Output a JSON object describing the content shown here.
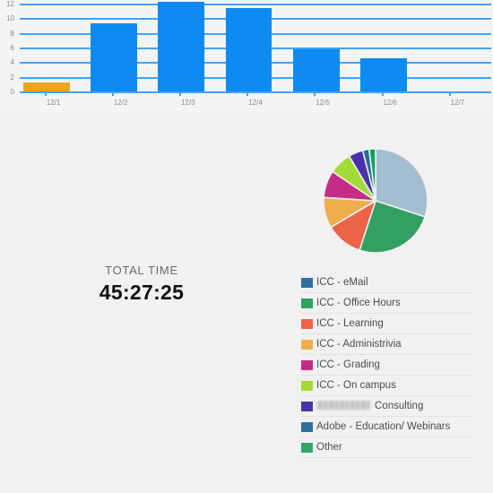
{
  "chart_data": [
    {
      "type": "bar",
      "title": "",
      "xlabel": "",
      "ylabel": "",
      "categories": [
        "12/1",
        "12/2",
        "12/3",
        "12/4",
        "12/5",
        "12/6",
        "12/7"
      ],
      "values": [
        1.5,
        9.6,
        12.5,
        11.6,
        6.0,
        4.8,
        0.1
      ],
      "colors": [
        "#eda323",
        "#0d8bf2",
        "#0d8bf2",
        "#0d8bf2",
        "#0d8bf2",
        "#0d8bf2",
        "#eda323"
      ],
      "ylim": [
        0,
        12
      ],
      "yticks": [
        0,
        2,
        4,
        6,
        8,
        10,
        12
      ],
      "ytick_labels": [
        "0",
        "2",
        "4",
        "6",
        "8",
        "10",
        "12"
      ],
      "grid": true,
      "legend": "none",
      "gridline_color": "#41a3f5",
      "plot_background": "#f4f4f4"
    },
    {
      "type": "pie",
      "title": "",
      "legend_position": "below",
      "labels": [
        "ICC - eMail",
        "ICC - Office Hours",
        "ICC - Learning",
        "ICC - Administrivia",
        "ICC - Grading",
        "ICC - On campus",
        "Consulting",
        "Adobe - Education/ Webinars",
        "Other"
      ],
      "values": [
        30.0,
        25.0,
        11.5,
        9.5,
        8.5,
        7.0,
        4.5,
        2.0,
        2.0
      ],
      "colors": [
        "#a3bdd1",
        "#33a061",
        "#ed6346",
        "#efae4e",
        "#c42d85",
        "#a3db36",
        "#4a32ad",
        "#256d9c",
        "#13a05a"
      ]
    }
  ],
  "bar_chart": {
    "ytick_labels": [
      "12",
      "10",
      "8",
      "6",
      "4",
      "2",
      "0"
    ],
    "xtick_labels": [
      "12/1",
      "12/2",
      "12/3",
      "12/4",
      "12/5",
      "12/6",
      "12/7"
    ]
  },
  "total_time": {
    "label": "TOTAL TIME",
    "value": "45:27:25"
  },
  "legend": {
    "items": [
      {
        "label": "ICC - eMail",
        "color": "#2e6f9e",
        "redacted": false
      },
      {
        "label": "ICC - Office Hours",
        "color": "#2fa360",
        "redacted": false
      },
      {
        "label": "ICC - Learning",
        "color": "#ef6245",
        "redacted": false
      },
      {
        "label": "ICC - Administrivia",
        "color": "#efae4e",
        "redacted": false
      },
      {
        "label": "ICC - Grading",
        "color": "#c42d85",
        "redacted": false
      },
      {
        "label": "ICC - On campus",
        "color": "#a3db36",
        "redacted": false
      },
      {
        "label": "Consulting",
        "color": "#4a32ad",
        "redacted": true
      },
      {
        "label": "Adobe - Education/ Webinars",
        "color": "#2e6f9e",
        "redacted": false
      },
      {
        "label": "Other",
        "color": "#2fa86a",
        "redacted": false
      }
    ]
  },
  "colors": {
    "page_background": "#f1f1f1",
    "bar_blue": "#0d8bf2",
    "bar_orange": "#eda323",
    "gridline": "#41a3f5",
    "axis_text": "#8a8a8a"
  }
}
